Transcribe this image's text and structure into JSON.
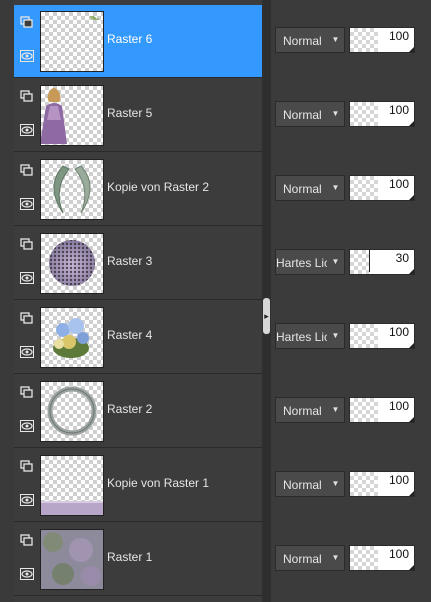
{
  "layers_panel": {
    "layers": [
      {
        "name": "Raster 6",
        "blend_mode": "Normal",
        "opacity": "100",
        "opacity_fraction": 1.0,
        "selected": true,
        "thumbnail": "transparent-with-small-green-sprig"
      },
      {
        "name": "Raster 5",
        "blend_mode": "Normal",
        "opacity": "100",
        "opacity_fraction": 1.0,
        "selected": false,
        "thumbnail": "woman-in-purple-dress"
      },
      {
        "name": "Kopie von Raster 2",
        "blend_mode": "Normal",
        "opacity": "100",
        "opacity_fraction": 1.0,
        "selected": false,
        "thumbnail": "grey-green-swirl-frame"
      },
      {
        "name": "Raster 3",
        "blend_mode": "Hartes Licht",
        "opacity": "30",
        "opacity_fraction": 0.3,
        "selected": false,
        "thumbnail": "dotted-lilac-circle"
      },
      {
        "name": "Raster 4",
        "blend_mode": "Hartes Licht",
        "opacity": "100",
        "opacity_fraction": 1.0,
        "selected": false,
        "thumbnail": "blue-flower-cluster"
      },
      {
        "name": "Raster 2",
        "blend_mode": "Normal",
        "opacity": "100",
        "opacity_fraction": 1.0,
        "selected": false,
        "thumbnail": "grey-circle-ring"
      },
      {
        "name": "Kopie von Raster 1",
        "blend_mode": "Normal",
        "opacity": "100",
        "opacity_fraction": 1.0,
        "selected": false,
        "thumbnail": "transparent-with-lilac-bottom-band"
      },
      {
        "name": "Raster 1",
        "blend_mode": "Normal",
        "opacity": "100",
        "opacity_fraction": 1.0,
        "selected": false,
        "thumbnail": "purple-green-texture"
      }
    ]
  },
  "icons": {
    "link": "layer-group-link-icon",
    "visibility": "eye-icon",
    "dropdown": "chevron-down-icon",
    "splitter": "chevron-right-icon"
  },
  "colors": {
    "selection": "#3399ff",
    "panel_bg": "#3c3c3c",
    "text": "#e6e6e6"
  }
}
